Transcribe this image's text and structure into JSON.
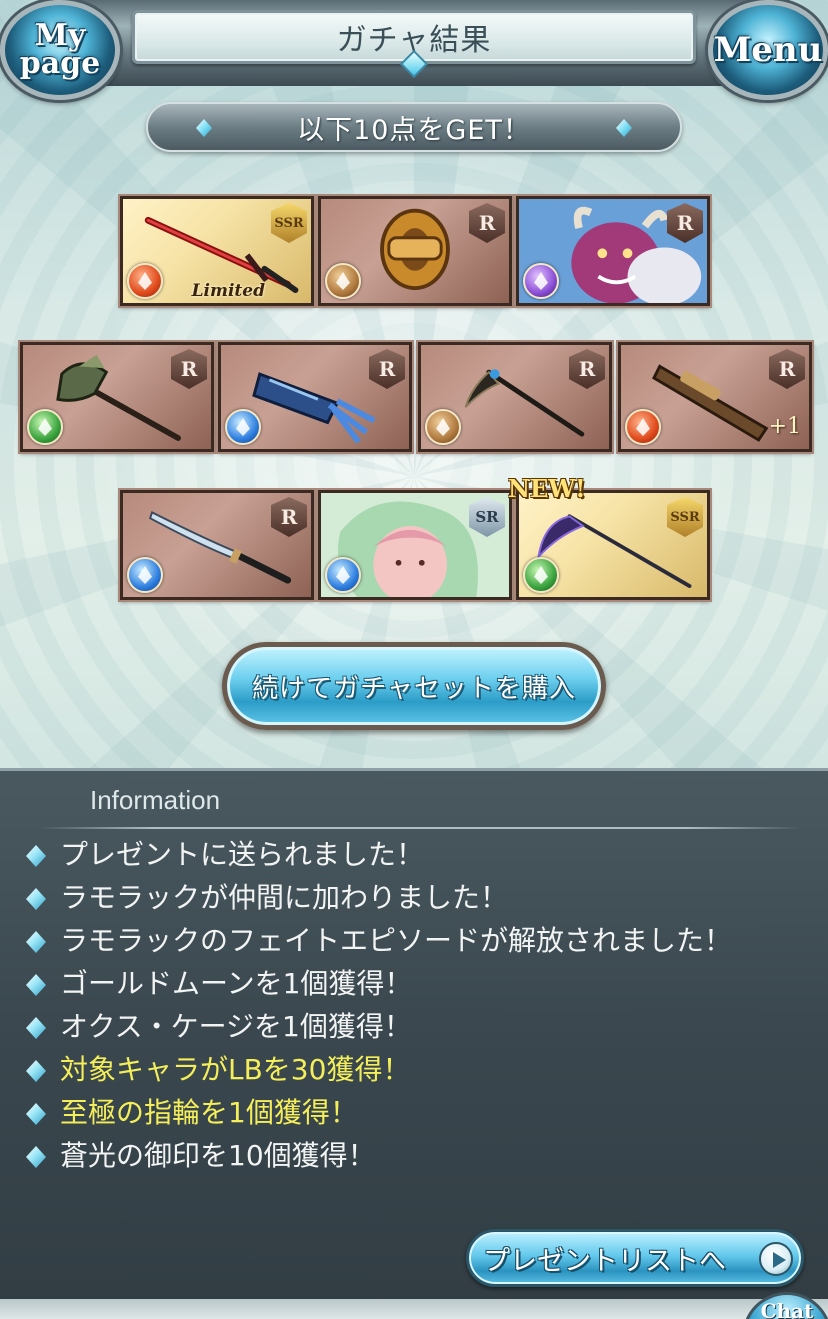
{
  "header": {
    "title": "ガチャ結果",
    "mypage_label": "My page",
    "menu_label": "Menu"
  },
  "subtitle": "以下10点をGET！",
  "items": [
    {
      "rarity": "SSR",
      "element": "fire",
      "kind": "sword",
      "badge": "Limited"
    },
    {
      "rarity": "R",
      "element": "earth",
      "kind": "knuckle"
    },
    {
      "rarity": "R",
      "element": "dark",
      "kind": "summon"
    },
    {
      "rarity": "R",
      "element": "wind",
      "kind": "axe"
    },
    {
      "rarity": "R",
      "element": "water",
      "kind": "gauntlet"
    },
    {
      "rarity": "R",
      "element": "earth",
      "kind": "scythe"
    },
    {
      "rarity": "R",
      "element": "fire",
      "kind": "gun",
      "badge": "+1"
    },
    {
      "rarity": "R",
      "element": "water",
      "kind": "katana"
    },
    {
      "rarity": "SR",
      "element": "water",
      "kind": "character"
    },
    {
      "rarity": "SSR",
      "element": "wind",
      "kind": "spear",
      "new": "NEW!"
    }
  ],
  "continue_button": "続けてガチャセットを購入",
  "information": {
    "heading": "Information",
    "lines": [
      {
        "text": "プレゼントに送られました！"
      },
      {
        "text": "ラモラックが仲間に加わりました！"
      },
      {
        "text": "ラモラックのフェイトエピソードが解放されました！"
      },
      {
        "text": "ゴールドムーンを1個獲得！"
      },
      {
        "text": "オクス・ケージを1個獲得！"
      },
      {
        "text": "対象キャラがLBを30獲得！",
        "highlight": true
      },
      {
        "text": "至極の指輪を1個獲得！",
        "highlight": true
      },
      {
        "text": "蒼光の御印を10個獲得！"
      }
    ]
  },
  "present_button": "プレゼントリストへ",
  "chat_label": "Chat",
  "colors": {
    "highlight_text": "#f4ee5a",
    "accent_blue": "#2c9dc8"
  }
}
